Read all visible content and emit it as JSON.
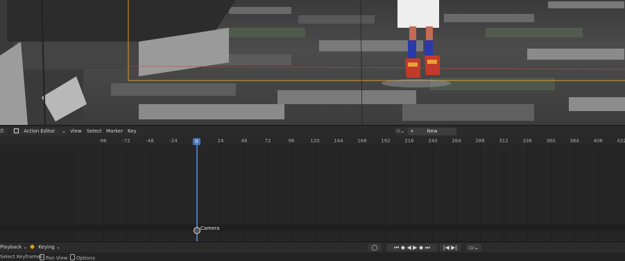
{
  "header": {
    "editor_type_icon": "dopesheet-icon",
    "mode": "Action Editor",
    "menus": [
      "View",
      "Select",
      "Marker",
      "Key"
    ],
    "new_label": "New"
  },
  "ruler": {
    "ticks": [
      "-96",
      "-72",
      "-48",
      "-24",
      "0",
      "24",
      "48",
      "72",
      "96",
      "120",
      "144",
      "168",
      "192",
      "216",
      "240",
      "264",
      "288",
      "312",
      "336",
      "360",
      "384",
      "408",
      "432"
    ],
    "current_frame": "0"
  },
  "channels": {
    "object_label": "Camera"
  },
  "playback": {
    "playback_label": "Playback",
    "keying_label": "Keying",
    "controls": [
      "jump-start",
      "prev-keyframe",
      "play-reverse",
      "play",
      "next-keyframe",
      "jump-end"
    ]
  },
  "status": {
    "items": [
      "Select Keyframes",
      "Pan View",
      "Options"
    ]
  },
  "colors": {
    "accent": "#4a78b8",
    "keying": "#e8a020",
    "selection_outline": "#e0a030"
  }
}
